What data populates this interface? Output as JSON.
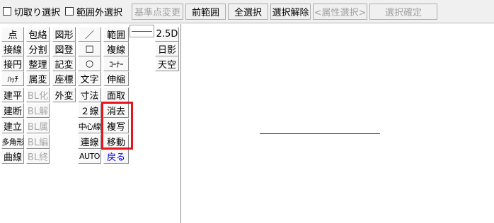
{
  "toolbar": {
    "clip_select": "切取り選択",
    "out_of_range_select": "範囲外選択",
    "change_base_point": "基準点変更",
    "prev_range": "前範囲",
    "select_all": "全選択",
    "deselect": "選択解除",
    "attr_select": "<属性選択>",
    "confirm_select": "選択確定"
  },
  "col1": [
    "点",
    "接線",
    "接円",
    "ﾊｯﾁ",
    "建平",
    "建断",
    "建立",
    "多角形",
    "曲線"
  ],
  "col2": [
    "包絡",
    "分割",
    "整理",
    "属変",
    "BL化",
    "BL解",
    "BL属",
    "BL編",
    "BL終"
  ],
  "col3": [
    "図形",
    "図登",
    "記変",
    "座標",
    "外変"
  ],
  "col4": [
    "／",
    "□",
    "○",
    "文字",
    "寸法",
    "２線",
    "中心線",
    "連線",
    "AUTO"
  ],
  "col5": [
    "範囲",
    "複線",
    "ｺｰﾅｰ",
    "伸縮",
    "面取",
    "消去",
    "複写",
    "移動",
    "戻る"
  ],
  "col6": [
    "2.5D",
    "日影",
    "天空"
  ],
  "colors": {
    "highlight": "#e8141c",
    "link": "#0000ee"
  }
}
